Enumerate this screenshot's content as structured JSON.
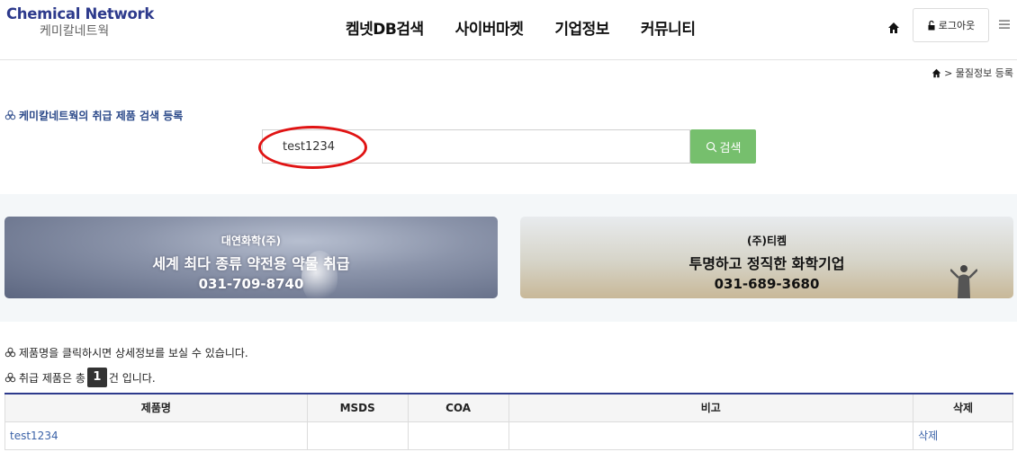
{
  "header": {
    "logo_en": "Chemical Network",
    "logo_ko": "케미칼네트웍",
    "nav": [
      "켐넷DB검색",
      "사이버마켓",
      "기업정보",
      "커뮤니티"
    ],
    "logout_label": "로그아웃"
  },
  "breadcrumb": "> 물질정보 등록",
  "section_title": "케미칼네트웍의 취급 제품 검색 등록",
  "search": {
    "value": "test1234",
    "button_label": "검색"
  },
  "banners": [
    {
      "company": "대연화학(주)",
      "slogan": "세계 최다 종류 약전용 약물 취급",
      "phone": "031-709-8740"
    },
    {
      "company": "(주)티켐",
      "slogan": "투명하고 정직한 화학기업",
      "phone": "031-689-3680"
    }
  ],
  "info": {
    "line1": "제품명을 클릭하시면 상세정보를 보실 수 있습니다.",
    "line2_prefix": "취급 제품은 총",
    "count": "1",
    "line2_suffix": "건 입니다."
  },
  "table": {
    "headers": [
      "제품명",
      "MSDS",
      "COA",
      "비고",
      "삭제"
    ],
    "rows": [
      {
        "name": "test1234",
        "msds": "",
        "coa": "",
        "note": "",
        "delete": "삭제"
      }
    ]
  },
  "colors": {
    "brand": "#2d3a8c",
    "search_button": "#76bf6d",
    "highlight": "#e01313",
    "link": "#3c63a8"
  }
}
